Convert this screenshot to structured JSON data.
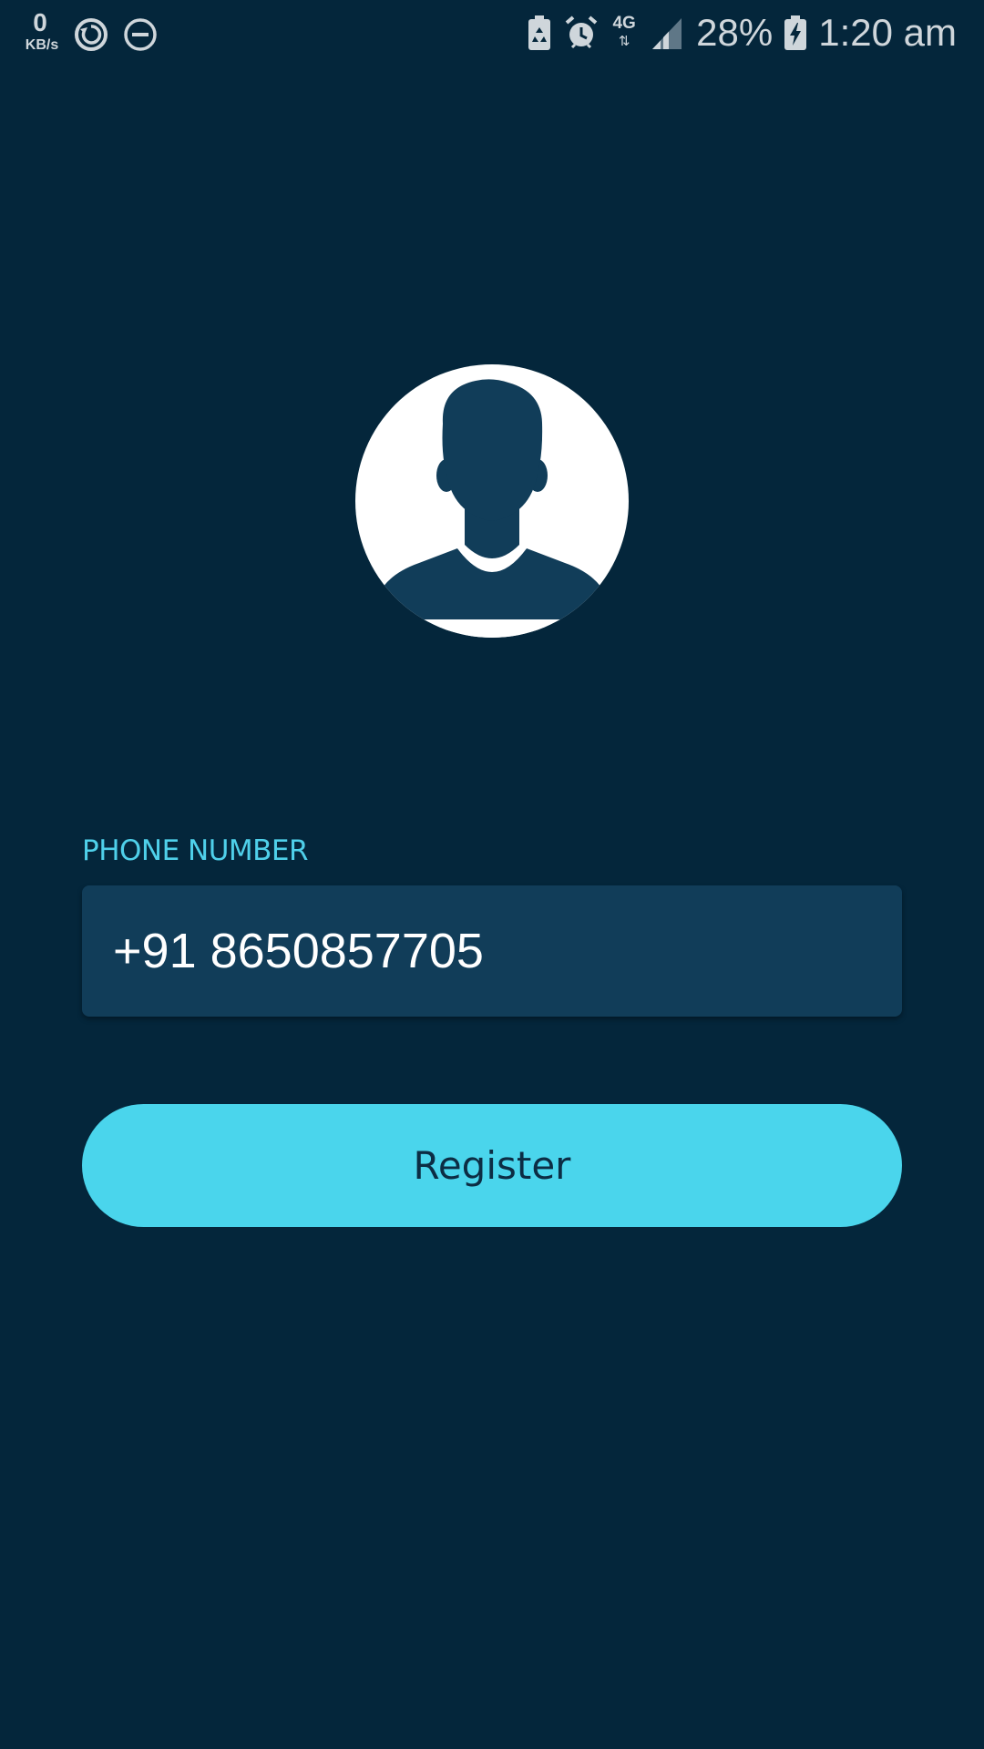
{
  "status_bar": {
    "net_speed_value": "0",
    "net_speed_unit": "KB/s",
    "network_type": "4G",
    "network_arrows": "⇅",
    "battery_percent": "28%",
    "time": "1:20 am",
    "icons": [
      "sync-icon",
      "do-not-disturb-icon",
      "battery-saver-icon",
      "alarm-icon",
      "signal-icon",
      "battery-charging-icon"
    ]
  },
  "avatar": {
    "icon": "user-avatar-icon"
  },
  "phone": {
    "label": "PHONE NUMBER",
    "value": "+91 8650857705"
  },
  "register_button": {
    "label": "Register"
  },
  "colors": {
    "background": "#04263b",
    "field_background": "#113d59",
    "accent": "#4ad5ec",
    "label": "#4fd0ea",
    "avatar_silhouette": "#113d59"
  }
}
